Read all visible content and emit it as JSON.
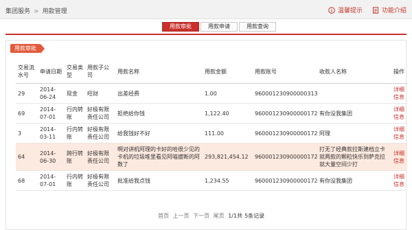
{
  "breadcrumb": {
    "root": "集团服务",
    "separator": ">",
    "current": "用款管理"
  },
  "actions": {
    "tip": "温馨提示",
    "intro": "功能介绍"
  },
  "tabs": [
    "用款审批",
    "用款申请",
    "用款查询"
  ],
  "panel": {
    "title": "用款审批"
  },
  "table": {
    "headers": [
      "交易流水号",
      "申请日期",
      "交易类型",
      "用款子公司",
      "用款名称",
      "用款金额",
      "用款账号",
      "收款人名称",
      "操作"
    ],
    "rows": [
      {
        "serial": "29",
        "date": "2014-06-24",
        "type": "现金",
        "company": "旺财",
        "name": "出差经费",
        "amount": "1.00",
        "account": "960001230900000313",
        "payee": "",
        "op": "详细信息"
      },
      {
        "serial": "69",
        "date": "2014-07-01",
        "type": "行内转账",
        "company": "好极有限责任公司",
        "name": "拒绝给你钱",
        "amount": "1,122.40",
        "account": "960001230900000172",
        "payee": "有你没我集团",
        "op": "详细信息"
      },
      {
        "serial": "3",
        "date": "2014-03-11",
        "type": "行内转账",
        "company": "好极有限责任公司",
        "name": "给我钱好不好",
        "amount": "111.00",
        "account": "960001230900000172",
        "payee": "阿理",
        "op": "详细信息"
      },
      {
        "serial": "64",
        "date": "2014-06-30",
        "type": "跨行转账",
        "company": "好极有限责任公司",
        "name": "啊对讲机阿理的卡好的哈很少见的卡机的垃圾堆里看见阿喵拔断的阿数了",
        "amount": "293,821,454.12",
        "account": "960001230900000172",
        "payee": "打无了经典款拉斯建档立卡就两款的颗粒快乐到萨克拉就大量空间少打",
        "op": "详细信息"
      },
      {
        "serial": "68",
        "date": "2014-07-01",
        "type": "行内转账",
        "company": "好极有限责任公司",
        "name": "批准给我点钱",
        "amount": "1,234.55",
        "account": "960001230900000172",
        "payee": "有你没我集团",
        "op": "详细信息"
      }
    ]
  },
  "pager": {
    "first": "首页",
    "prev": "上一页",
    "next": "下一页",
    "last": "尾页",
    "pages": "1/1共",
    "count": "5条记录"
  },
  "colors": {
    "accent": "#c9302c",
    "highlight": "#fce9df",
    "tag": "#e35a3b"
  }
}
